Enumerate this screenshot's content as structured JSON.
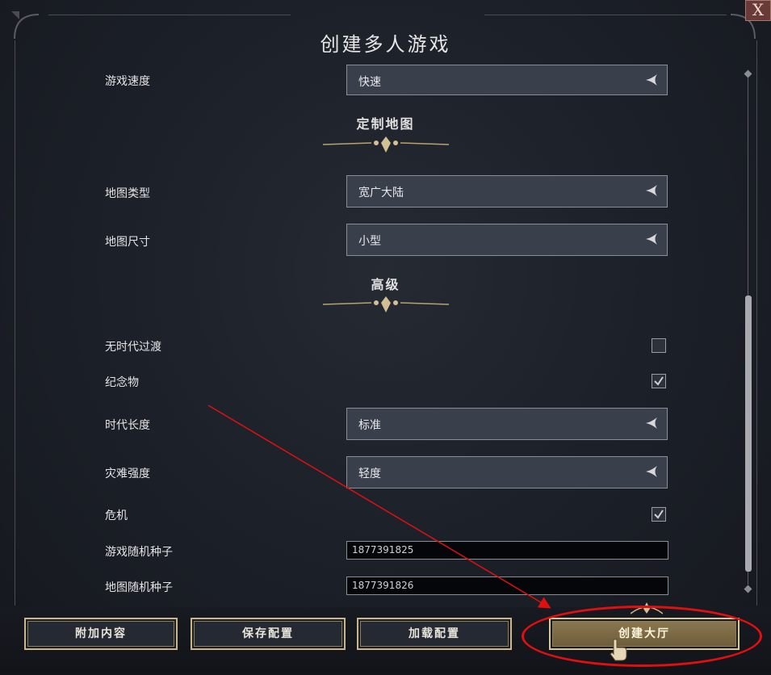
{
  "window": {
    "title": "创建多人游戏",
    "close_label": "X"
  },
  "rows": {
    "game_speed": {
      "label": "游戏速度",
      "value": "快速"
    },
    "map_type": {
      "label": "地图类型",
      "value": "宽广大陆"
    },
    "map_size": {
      "label": "地图尺寸",
      "value": "小型"
    },
    "no_age_transition": {
      "label": "无时代过渡",
      "checked": false
    },
    "monuments": {
      "label": "纪念物",
      "checked": true
    },
    "age_length": {
      "label": "时代长度",
      "value": "标准"
    },
    "disaster_intensity": {
      "label": "灾难强度",
      "value": "轻度"
    },
    "crisis": {
      "label": "危机",
      "checked": true
    },
    "game_seed": {
      "label": "游戏随机种子",
      "value": "1877391825"
    },
    "map_seed": {
      "label": "地图随机种子",
      "value": "1877391826"
    }
  },
  "sections": {
    "custom_map": "定制地图",
    "advanced": "高级"
  },
  "buttons": {
    "additional_content": "附加内容",
    "save_config": "保存配置",
    "load_config": "加载配置",
    "create_lobby": "创建大厅"
  },
  "colors": {
    "accent_gold": "#c9b68a",
    "annotation_red": "#e01010",
    "panel_bg": "#1b1f27"
  },
  "annotation": {
    "arrow_target": "create-lobby-button"
  }
}
